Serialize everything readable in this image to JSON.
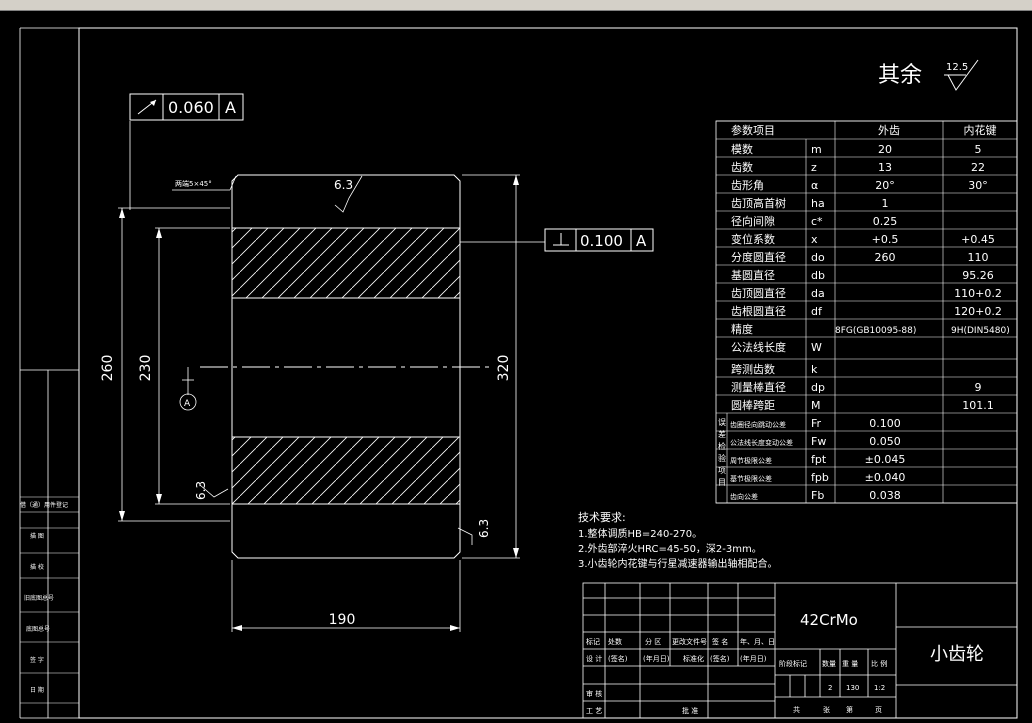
{
  "toolbar": {
    "items": [
      "",
      "",
      "",
      "",
      ""
    ]
  },
  "title_note": {
    "text": "其余",
    "roughness": "12.5"
  },
  "tolerances": {
    "runout": {
      "value": "0.060",
      "datum": "A"
    },
    "perpendicular": {
      "value": "0.100",
      "datum": "A"
    },
    "datum_label": "A"
  },
  "dimensions": {
    "d260": "260",
    "d230": "230",
    "d320": "320",
    "d190": "190",
    "r1": "6.3",
    "r2": "6.3",
    "r3": "6.3",
    "chamfer": "两端5×45°"
  },
  "param_table": {
    "headers": [
      "参数项目",
      "外齿",
      "内花键"
    ],
    "rows": [
      [
        "模数",
        "m",
        "20",
        "5"
      ],
      [
        "齿数",
        "z",
        "13",
        "22"
      ],
      [
        "齿形角",
        "α",
        "20°",
        "30°"
      ],
      [
        "齿顶高首树",
        "ha",
        "1",
        ""
      ],
      [
        "径向间隙",
        "c*",
        "0.25",
        ""
      ],
      [
        "变位系数",
        "x",
        "+0.5",
        "+0.45"
      ],
      [
        "分度圆直径",
        "do",
        "260",
        "110"
      ],
      [
        "基圆直径",
        "db",
        "",
        "95.26"
      ],
      [
        "齿顶圆直径",
        "da",
        "",
        "110+0.2"
      ],
      [
        "齿根圆直径",
        "df",
        "",
        "120+0.2"
      ],
      [
        "精度",
        "",
        "8FG(GB10095-88)",
        "9H(DIN5480)"
      ],
      [
        "公法线长度",
        "W",
        "",
        ""
      ],
      [
        "跨测齿数",
        "k",
        "",
        ""
      ],
      [
        "测量棒直径",
        "dp",
        "",
        "9"
      ],
      [
        "圆棒跨距",
        "M",
        "",
        "101.1"
      ],
      [
        "齿圈径向跳动公差",
        "Fr",
        "0.100",
        ""
      ],
      [
        "公法线长度变动公差",
        "Fw",
        "0.050",
        ""
      ],
      [
        "周节极限公差",
        "fpt",
        "±0.045",
        ""
      ],
      [
        "基节极限公差",
        "fpb",
        "±0.040",
        ""
      ],
      [
        "齿向公差",
        "Fb",
        "0.038",
        ""
      ]
    ],
    "group_label": "误差检验项目"
  },
  "tech_req": {
    "title": "技术要求:",
    "lines": [
      "1.整体调质HB=240-270。",
      "2.外齿部淬火HRC=45-50，深2-3mm。",
      "3.小齿轮内花键与行星减速器输出轴相配合。"
    ]
  },
  "title_block": {
    "material": "42CrMo",
    "part_name": "小齿轮",
    "row_labels": [
      "标记",
      "处数",
      "分 区",
      "更改文件号",
      "签 名",
      "年、月、日"
    ],
    "row2": [
      "设 计",
      "(签名)",
      "(年月日)",
      "标准化",
      "(签名)",
      "(年月日)"
    ],
    "stage_labels": [
      "阶段标记",
      "数量",
      "重 量",
      "比 例"
    ],
    "stage_values": [
      "2",
      "130",
      "1:2"
    ],
    "audit": "审 核",
    "process": "工 艺",
    "approve": "批 准",
    "sheet": [
      "共",
      "张",
      "第",
      "页"
    ]
  },
  "side_block": [
    "借（通）用件登记",
    "描 图",
    "描 校",
    "旧底图总号",
    "底图总号",
    "签 字",
    "日 期"
  ]
}
